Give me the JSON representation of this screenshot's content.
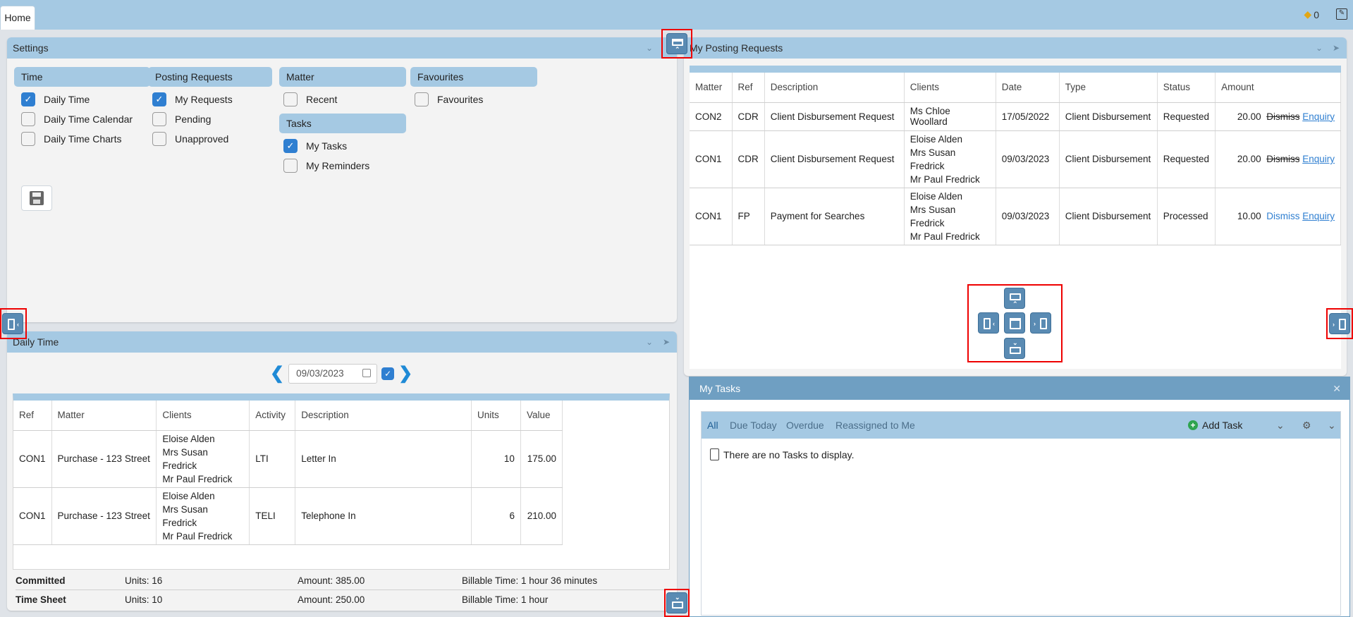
{
  "topbar": {
    "home_tab": "Home",
    "notification_count": "0"
  },
  "settings": {
    "title": "Settings",
    "groups": {
      "time": {
        "label": "Time",
        "items": [
          {
            "label": "Daily Time",
            "checked": true
          },
          {
            "label": "Daily Time Calendar",
            "checked": false
          },
          {
            "label": "Daily Time Charts",
            "checked": false
          }
        ]
      },
      "posting": {
        "label": "Posting Requests",
        "items": [
          {
            "label": "My Requests",
            "checked": true
          },
          {
            "label": "Pending",
            "checked": false
          },
          {
            "label": "Unapproved",
            "checked": false
          }
        ]
      },
      "matter": {
        "label": "Matter",
        "items": [
          {
            "label": "Recent",
            "checked": false
          }
        ]
      },
      "tasks": {
        "label": "Tasks",
        "items": [
          {
            "label": "My Tasks",
            "checked": true
          },
          {
            "label": "My Reminders",
            "checked": false
          }
        ]
      },
      "favourites": {
        "label": "Favourites",
        "items": [
          {
            "label": "Favourites",
            "checked": false
          }
        ]
      }
    }
  },
  "posting_requests": {
    "title": "My Posting Requests",
    "columns": [
      "Matter",
      "Ref",
      "Description",
      "Clients",
      "Date",
      "Type",
      "Status",
      "Amount"
    ],
    "rows": [
      {
        "matter": "CON2",
        "ref": "CDR",
        "description": "Client Disbursement Request",
        "clients": [
          "Ms Chloe Woollard"
        ],
        "date": "17/05/2022",
        "type": "Client Disbursement",
        "status": "Requested",
        "amount": "20.00",
        "dismiss": "Dismiss",
        "enquiry": "Enquiry"
      },
      {
        "matter": "CON1",
        "ref": "CDR",
        "description": "Client Disbursement Request",
        "clients": [
          "Eloise Alden",
          "Mrs Susan Fredrick",
          "Mr Paul Fredrick"
        ],
        "date": "09/03/2023",
        "type": "Client Disbursement",
        "status": "Requested",
        "amount": "20.00",
        "dismiss": "Dismiss",
        "enquiry": "Enquiry"
      },
      {
        "matter": "CON1",
        "ref": "FP",
        "description": "Payment for Searches",
        "clients": [
          "Eloise Alden",
          "Mrs Susan Fredrick",
          "Mr Paul Fredrick"
        ],
        "date": "09/03/2023",
        "type": "Client Disbursement",
        "status": "Processed",
        "amount": "10.00",
        "dismiss": "Dismiss",
        "enquiry": "Enquiry"
      }
    ]
  },
  "daily_time": {
    "title": "Daily Time",
    "date": "09/03/2023",
    "columns": [
      "Ref",
      "Matter",
      "Clients",
      "Activity",
      "Description",
      "Units",
      "Value"
    ],
    "rows": [
      {
        "ref": "CON1",
        "matter": "Purchase - 123 Street",
        "clients": [
          "Eloise Alden",
          "Mrs Susan Fredrick",
          "Mr Paul Fredrick"
        ],
        "activity": "LTI",
        "description": "Letter In",
        "units": "10",
        "value": "175.00"
      },
      {
        "ref": "CON1",
        "matter": "Purchase - 123 Street",
        "clients": [
          "Eloise Alden",
          "Mrs Susan Fredrick",
          "Mr Paul Fredrick"
        ],
        "activity": "TELI",
        "description": "Telephone In",
        "units": "6",
        "value": "210.00"
      }
    ],
    "committed": {
      "label": "Committed",
      "units": "Units: 16",
      "amount": "Amount: 385.00",
      "billable": "Billable Time: 1 hour 36 minutes"
    },
    "timesheet": {
      "label": "Time Sheet",
      "units": "Units: 10",
      "amount": "Amount: 250.00",
      "billable": "Billable Time: 1 hour"
    }
  },
  "tasks": {
    "title": "My Tasks",
    "tabs": [
      "All",
      "Due Today",
      "Overdue",
      "Reassigned to Me"
    ],
    "add_task": "Add Task",
    "empty": "There are no Tasks to display."
  },
  "colors": {
    "header": "#a5c9e3",
    "accent": "#2f7fd1",
    "dock_highlight": "#e00000"
  }
}
